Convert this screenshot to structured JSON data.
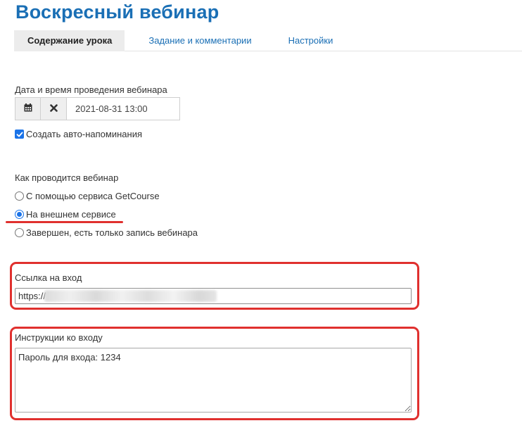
{
  "page": {
    "title": "Воскресный вебинар"
  },
  "tabs": [
    {
      "label": "Содержание урока",
      "active": true
    },
    {
      "label": "Задание и комментарии",
      "active": false
    },
    {
      "label": "Настройки",
      "active": false
    }
  ],
  "datetime": {
    "label": "Дата и время проведения вебинара",
    "value": "2021-08-31 13:00",
    "calendar_icon": "calendar-icon",
    "clear_icon": "close-icon"
  },
  "auto_reminders": {
    "label": "Создать авто-напоминания",
    "checked": true
  },
  "webinar_mode": {
    "label": "Как проводится вебинар",
    "options": [
      {
        "label": "С помощью сервиса GetCourse",
        "selected": false
      },
      {
        "label": "На внешнем сервисе",
        "selected": true
      },
      {
        "label": "Завершен, есть только запись вебинара",
        "selected": false
      }
    ]
  },
  "entry_link": {
    "label": "Ссылка на вход",
    "value": "https://"
  },
  "entry_instructions": {
    "label": "Инструкции ко входу",
    "value": "Пароль для входа: 1234"
  },
  "colors": {
    "title": "#1a6fb5",
    "link": "#1a6fb5",
    "highlight": "#e0302e",
    "accent": "#1a73e8"
  }
}
